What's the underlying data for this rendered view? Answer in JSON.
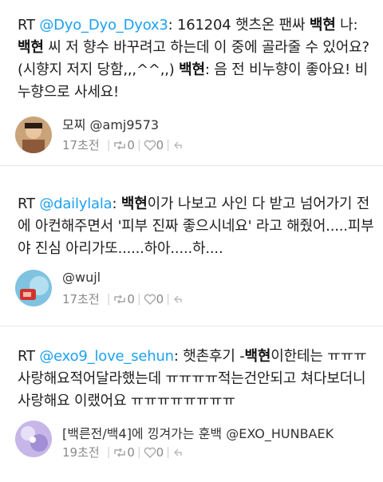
{
  "tweets": [
    {
      "rt": "RT",
      "mention": "@Dyo_Dyo_Dyox3",
      "seg1": ": 161204 햇츠온 팬싸 ",
      "kw1": "백현",
      "seg2": " 나: ",
      "kw2": "백현",
      "seg3": " 씨 저 향수 바꾸려고 하는데 이 중에 골라줄 수 있어요? (시향지 저지 당함,,,^^,,) ",
      "kw3": "백현",
      "seg4": ": 음 전 비누향이 좋아요! 비누향으로 사세요!",
      "author": "모찌 @amj9573",
      "time": "17초전",
      "retweets": "0",
      "likes": "0"
    },
    {
      "rt": "RT",
      "mention": "@dailylala",
      "seg1": ": ",
      "kw1": "백현",
      "seg2": "이가 나보고 사인 다 받고 넘어가기 전에 아컨해주면서 '피부 진짜 좋으시네요' 라고 해줬어.....피부야 진심 아리가또......하아.....하....",
      "author": "@wujl",
      "time": "17초전",
      "retweets": "0",
      "likes": "0"
    },
    {
      "rt": "RT",
      "mention": "@exo9_love_sehun",
      "seg1": ": 햇촌후기 -",
      "kw1": "백현",
      "seg2": "이한테는 ㅠㅠㅠ 사랑해요적어달라했는데 ㅠㅠㅠㅠ적는건안되고 쳐다보더니 사랑해요 이랬어요 ㅠㅠㅠㅠㅠㅠㅠㅠ",
      "author": "[백른전/백4]에 낑겨가는 훈백 @EXO_HUNBAEK",
      "time": "19초전",
      "retweets": "0",
      "likes": "0"
    }
  ],
  "colors": {
    "mention": "#1da1f2",
    "meta": "#8a8a8a",
    "divider": "#e6e6e6"
  },
  "icons": [
    "retweet-icon",
    "like-heart-icon",
    "reply-icon"
  ]
}
